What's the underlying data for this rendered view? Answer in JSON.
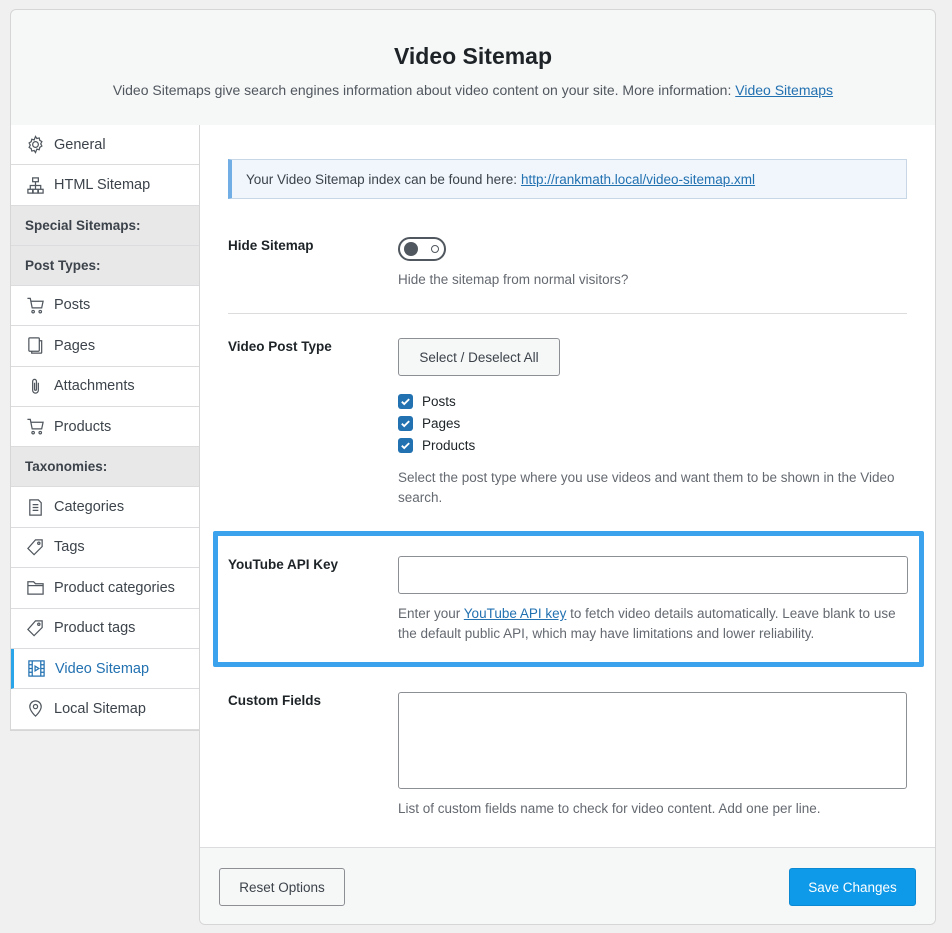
{
  "header": {
    "title": "Video Sitemap",
    "description": "Video Sitemaps give search engines information about video content on your site. More information:",
    "link_text": "Video Sitemaps"
  },
  "sidebar": {
    "items": [
      {
        "type": "item",
        "label": "General",
        "icon": "gear-icon"
      },
      {
        "type": "item",
        "label": "HTML Sitemap",
        "icon": "sitemap-icon"
      },
      {
        "type": "heading",
        "label": "Special Sitemaps:"
      },
      {
        "type": "heading",
        "label": "Post Types:"
      },
      {
        "type": "item",
        "label": "Posts",
        "icon": "cart-icon"
      },
      {
        "type": "item",
        "label": "Pages",
        "icon": "pages-icon"
      },
      {
        "type": "item",
        "label": "Attachments",
        "icon": "paperclip-icon"
      },
      {
        "type": "item",
        "label": "Products",
        "icon": "cart-icon"
      },
      {
        "type": "heading",
        "label": "Taxonomies:"
      },
      {
        "type": "item",
        "label": "Categories",
        "icon": "document-icon"
      },
      {
        "type": "item",
        "label": "Tags",
        "icon": "tag-icon"
      },
      {
        "type": "item",
        "label": "Product categories",
        "icon": "folder-icon"
      },
      {
        "type": "item",
        "label": "Product tags",
        "icon": "tag-icon"
      },
      {
        "type": "item",
        "label": "Video Sitemap",
        "icon": "video-icon",
        "active": true
      },
      {
        "type": "item",
        "label": "Local Sitemap",
        "icon": "location-pin-icon"
      }
    ]
  },
  "notice": {
    "text": "Your Video Sitemap index can be found here:",
    "link": "http://rankmath.local/video-sitemap.xml"
  },
  "hide_sitemap": {
    "label": "Hide Sitemap",
    "enabled": false,
    "help": "Hide the sitemap from normal visitors?"
  },
  "video_post_type": {
    "label": "Video Post Type",
    "button": "Select / Deselect All",
    "options": [
      {
        "label": "Posts",
        "checked": true
      },
      {
        "label": "Pages",
        "checked": true
      },
      {
        "label": "Products",
        "checked": true
      }
    ],
    "help": "Select the post type where you use videos and want them to be shown in the Video search."
  },
  "youtube_api": {
    "label": "YouTube API Key",
    "value": "",
    "help_before": "Enter your",
    "help_link": "YouTube API key",
    "help_after": "to fetch video details automatically. Leave blank to use the default public API, which may have limitations and lower reliability."
  },
  "custom_fields": {
    "label": "Custom Fields",
    "value": "",
    "help": "List of custom fields name to check for video content. Add one per line."
  },
  "footer": {
    "reset_label": "Reset Options",
    "save_label": "Save Changes"
  },
  "colors": {
    "accent": "#2271b1",
    "primary_button": "#0e9ae8",
    "highlight_border": "#3ba3ee"
  }
}
